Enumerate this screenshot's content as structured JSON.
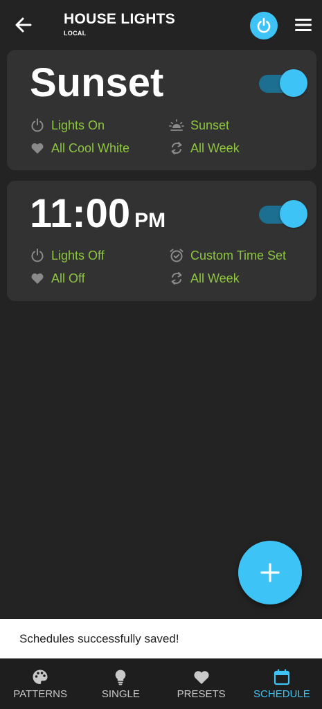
{
  "header": {
    "title": "HOUSE LIGHTS",
    "subtitle": "LOCAL",
    "back_icon": "arrow-left-icon",
    "power_icon": "power-icon",
    "menu_icon": "hamburger-menu-icon"
  },
  "schedules": [
    {
      "title": "Sunset",
      "enabled": true,
      "action": "Lights On",
      "trigger": "Sunset",
      "preset": "All Cool White",
      "repeat": "All Week"
    },
    {
      "time": "11:00",
      "ampm": "PM",
      "enabled": true,
      "action": "Lights Off",
      "trigger": "Custom Time Set",
      "preset": "All Off",
      "repeat": "All Week"
    }
  ],
  "fab": {
    "icon": "plus-icon"
  },
  "snackbar": {
    "message": "Schedules successfully saved!"
  },
  "nav": {
    "items": [
      {
        "label": "PATTERNS",
        "icon": "palette-icon"
      },
      {
        "label": "SINGLE",
        "icon": "lightbulb-icon"
      },
      {
        "label": "PRESETS",
        "icon": "heart-icon"
      },
      {
        "label": "SCHEDULE",
        "icon": "calendar-icon"
      }
    ],
    "active": "SCHEDULE"
  },
  "colors": {
    "background": "#232323",
    "card": "#323232",
    "accent": "#3ec3f6",
    "info_text": "#8dc63f",
    "toggle_track": "#1c6f90"
  }
}
